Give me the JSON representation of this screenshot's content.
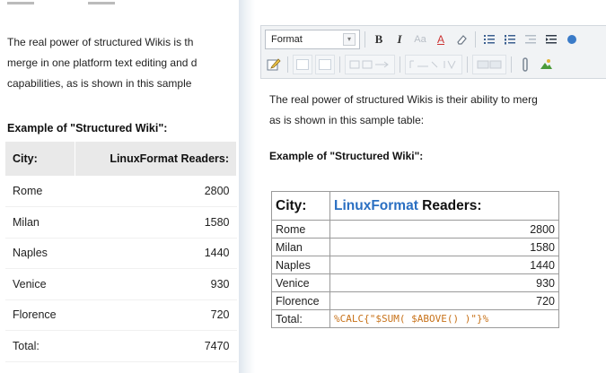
{
  "left": {
    "intro_lines": [
      "The real power of structured Wikis is th",
      "merge in one platform text editing and d",
      "capabilities, as is shown in this sample"
    ],
    "example_heading": "Example of \"Structured Wiki\":",
    "table": {
      "headers": [
        "City:",
        "LinuxFormat Readers:"
      ],
      "rows": [
        [
          "Rome",
          "2800"
        ],
        [
          "Milan",
          "1580"
        ],
        [
          "Naples",
          "1440"
        ],
        [
          "Venice",
          "930"
        ],
        [
          "Florence",
          "720"
        ],
        [
          "Total:",
          "7470"
        ]
      ]
    }
  },
  "editor": {
    "toolbar": {
      "format_label": "Format",
      "format_arrow": "▾",
      "bold": "B",
      "italic": "I",
      "font_size": "Aa",
      "text_color": "A",
      "remove_format": "⌫",
      "bullet_list": "☰",
      "numbered_list": "☰",
      "outdent": "⇤",
      "indent": "⇥"
    },
    "intro_lines": [
      "The real power of structured Wikis is their ability to merg",
      "as is shown in this sample table:"
    ],
    "example_heading": "Example of \"Structured Wiki\":",
    "table": {
      "header_city": "City:",
      "header_brand": "LinuxFormat",
      "header_rest": " Readers:",
      "rows": [
        [
          "Rome",
          "2800"
        ],
        [
          "Milan",
          "1580"
        ],
        [
          "Naples",
          "1440"
        ],
        [
          "Venice",
          "930"
        ],
        [
          "Florence",
          "720"
        ]
      ],
      "total_label": "Total:",
      "total_formula": "%CALC{\"$SUM( $ABOVE() )\"}%"
    }
  }
}
